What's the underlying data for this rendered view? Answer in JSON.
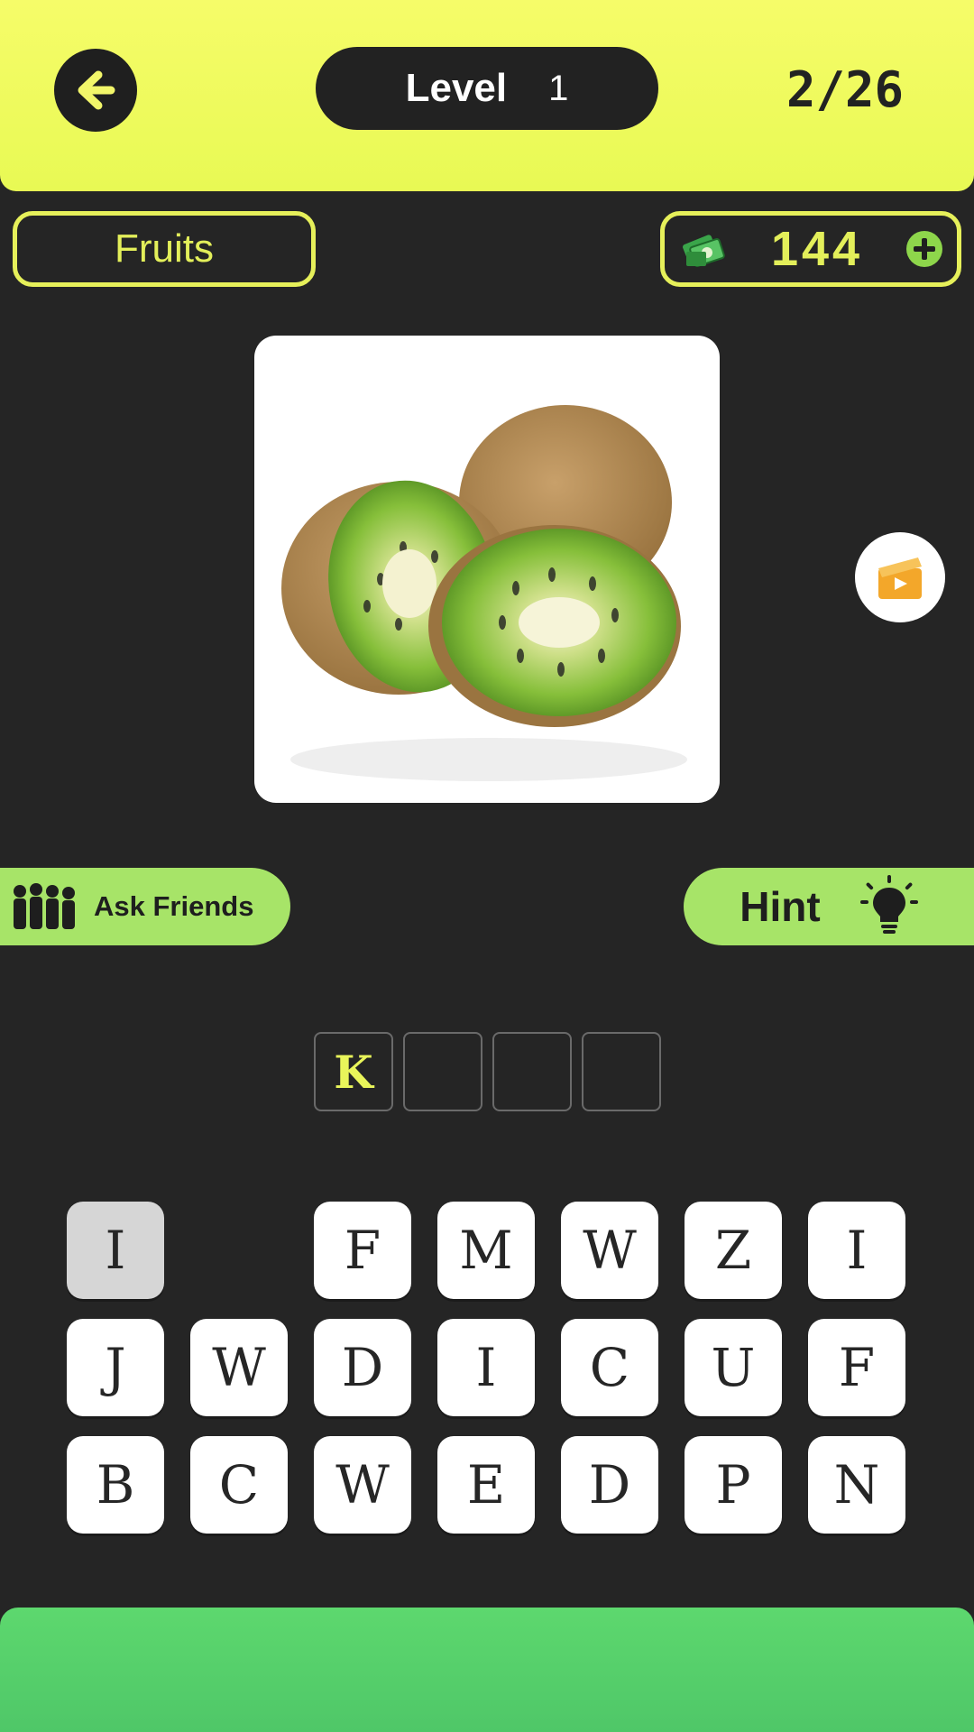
{
  "header": {
    "level_label": "Level",
    "level_number": "1",
    "progress": "2/26"
  },
  "category": {
    "label": "Fruits"
  },
  "coins": {
    "count": "144"
  },
  "buttons": {
    "ask_friends": "Ask Friends",
    "hint": "Hint"
  },
  "answer": {
    "slots": [
      "K",
      "",
      "",
      ""
    ]
  },
  "keyboard": {
    "rows": [
      [
        "I",
        "",
        "F",
        "M",
        "W",
        "Z",
        "I"
      ],
      [
        "J",
        "W",
        "D",
        "I",
        "C",
        "U",
        "F"
      ],
      [
        "B",
        "C",
        "W",
        "E",
        "D",
        "P",
        "N"
      ]
    ],
    "used_index": [
      0,
      0
    ]
  },
  "colors": {
    "accent_yellow": "#e6f05a",
    "hint_green": "#a7e468",
    "background": "#252525"
  }
}
